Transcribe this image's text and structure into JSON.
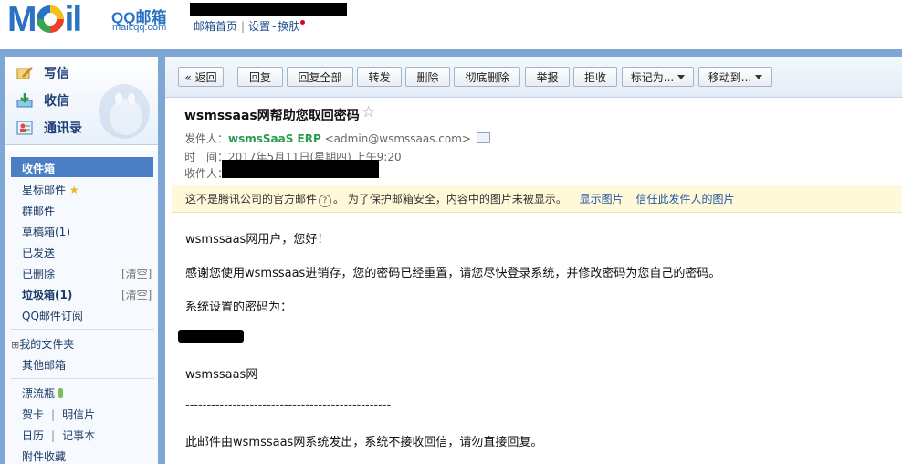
{
  "header": {
    "logo_text": "MOil",
    "brand": "QQ邮箱",
    "domain": "mail.qq.com",
    "links": [
      "邮箱首页",
      "设置",
      "换肤"
    ]
  },
  "nav": {
    "compose": "写信",
    "receive": "收信",
    "contacts": "通讯录",
    "folders": {
      "inbox": "收件箱",
      "starred": "星标邮件",
      "group": "群邮件",
      "drafts": "草稿箱(1)",
      "sent": "已发送",
      "deleted": "已删除",
      "deleted_action": "[清空]",
      "spam": "垃圾箱(1)",
      "spam_action": "[清空]",
      "subscription": "QQ邮件订阅",
      "my_folders": "我的文件夹",
      "other_mailbox": "其他邮箱",
      "bottle": "漂流瓶",
      "greeting_card": "贺卡",
      "postcard": "明信片",
      "calendar": "日历",
      "notes": "记事本",
      "attachments": "附件收藏"
    },
    "separator": "|",
    "expand_glyph": "⊞"
  },
  "toolbar": {
    "back": "« 返回",
    "reply": "回复",
    "reply_all": "回复全部",
    "forward": "转发",
    "delete": "删除",
    "delete_permanent": "彻底删除",
    "report": "举报",
    "reject": "拒收",
    "mark_as": "标记为...",
    "move_to": "移动到..."
  },
  "mail": {
    "subject": "wsmssaas网帮助您取回密码",
    "from_label": "发件人：",
    "from_name": "wsmsSaaS ERP",
    "from_email": "<admin@wsmssaas.com>",
    "time_label": "时　间：",
    "time_value": "2017年5月11日(星期四) 上午9:20",
    "to_label": "收件人：",
    "notice": "这不是腾讯公司的官方邮件",
    "notice_rest": "。 为了保护邮箱安全，内容中的图片未被显示。",
    "show_images": "显示图片",
    "trust_sender": "信任此发件人的图片",
    "body": {
      "greeting": "wsmssaas网用户，您好！",
      "para1": "感谢您使用wsmssaas进销存，您的密码已经重置，请您尽快登录系统，并修改密码为您自己的密码。",
      "pwd_intro": "系统设置的密码为：",
      "signature": "wsmssaas网",
      "divider": "------------------------------------------------",
      "footer": "此邮件由wsmssaas网系统发出，系统不接收回信，请勿直接回复。"
    }
  },
  "colors": {
    "frame": "#7ea7d6",
    "link": "#1f56a6",
    "sender": "#2b9a4f",
    "selected": "#4a7fc5",
    "notice_bg": "#fff8d9"
  }
}
